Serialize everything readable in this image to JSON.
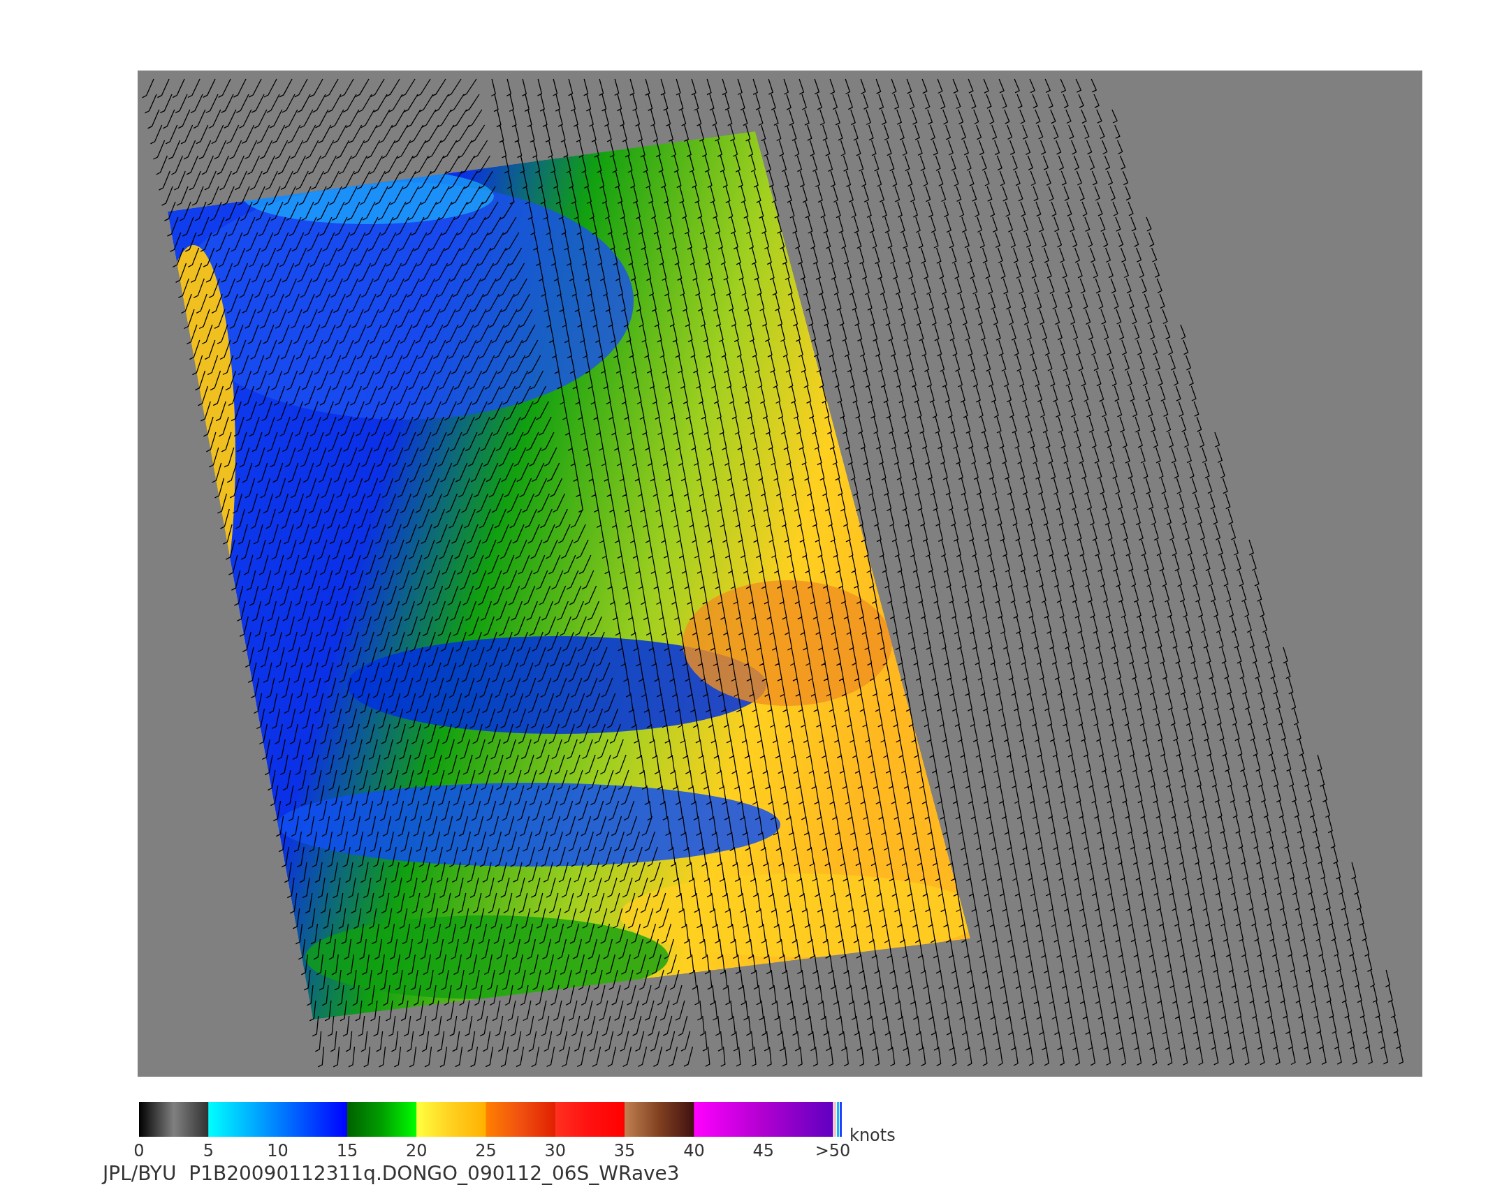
{
  "colorbar": {
    "ticks": [
      "0",
      "5",
      "10",
      "15",
      "20",
      "25",
      "30",
      "35",
      "40",
      "45",
      ">50"
    ],
    "units": "knots"
  },
  "caption": "JPL/BYU  P1B20090112311q.DONGO_090112_06S_WRave3"
}
